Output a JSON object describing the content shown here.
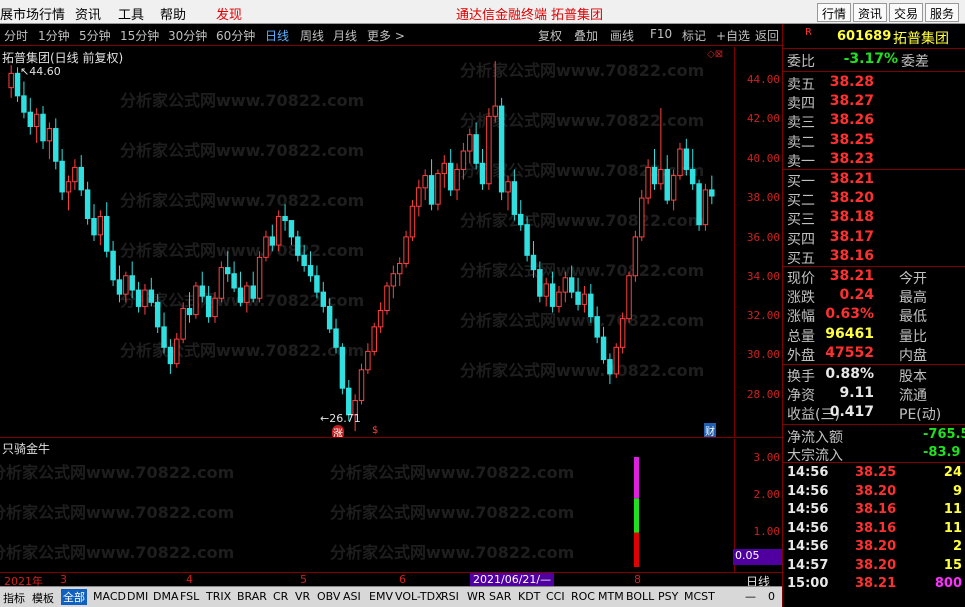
{
  "menu": {
    "items": [
      "展市场行情",
      "资讯",
      "工具",
      "帮助",
      "发现"
    ],
    "center_links": [
      "通达信金融终端",
      "拓普集团"
    ],
    "right_buttons": [
      "行情",
      "资讯",
      "交易",
      "服务"
    ]
  },
  "periods": [
    "分时",
    "1分钟",
    "5分钟",
    "15分钟",
    "30分钟",
    "60分钟",
    "日线",
    "周线",
    "月线",
    "更多 >"
  ],
  "selected_period": "日线",
  "toolbar": [
    "复权",
    "叠加",
    "画线",
    "F10",
    "标记",
    "+自选",
    "返回"
  ],
  "chart": {
    "title": "拓普集团(日线 前复权)",
    "high_marker": "44.60",
    "low_marker": "26.71",
    "price_ticks": [
      "44.00",
      "42.00",
      "40.00",
      "38.00",
      "36.00",
      "34.00",
      "32.00",
      "30.00",
      "28.00"
    ],
    "indicator_name": "只骑金牛",
    "indicator_ticks": [
      "3.00",
      "2.00",
      "1.00"
    ],
    "indicator_value": "0.05",
    "cursor_date": "2021/06/21/—",
    "period_label": "日线",
    "watermark": "分析家公式网www.70822.com",
    "badges": [
      "涨",
      "$",
      "财"
    ]
  },
  "chart_data": {
    "type": "candlestick",
    "title": "拓普集团(日线 前复权)",
    "ylim": [
      27,
      45
    ],
    "date_labels": [
      "2021年",
      "3",
      "4",
      "5",
      "6",
      "7",
      "8"
    ],
    "note_high": 44.6,
    "note_low": 26.71,
    "candles": [
      [
        43.5,
        44.6,
        43.0,
        44.2
      ],
      [
        44.2,
        44.5,
        42.8,
        43.1
      ],
      [
        43.1,
        43.8,
        42.0,
        42.3
      ],
      [
        42.3,
        43.0,
        41.2,
        41.6
      ],
      [
        41.6,
        42.5,
        40.8,
        42.2
      ],
      [
        42.2,
        42.6,
        40.5,
        40.9
      ],
      [
        40.9,
        41.8,
        40.0,
        41.5
      ],
      [
        41.5,
        42.0,
        39.5,
        39.9
      ],
      [
        39.9,
        40.5,
        38.0,
        38.4
      ],
      [
        38.4,
        39.2,
        37.5,
        38.9
      ],
      [
        38.9,
        40.0,
        38.5,
        39.6
      ],
      [
        39.6,
        40.2,
        38.2,
        38.5
      ],
      [
        38.5,
        38.9,
        36.8,
        37.1
      ],
      [
        37.1,
        37.8,
        36.0,
        36.3
      ],
      [
        36.3,
        37.5,
        35.8,
        37.2
      ],
      [
        37.2,
        37.9,
        35.2,
        35.5
      ],
      [
        35.5,
        36.0,
        33.8,
        34.1
      ],
      [
        34.1,
        34.8,
        33.0,
        33.4
      ],
      [
        33.4,
        34.5,
        33.0,
        34.3
      ],
      [
        34.3,
        35.0,
        33.2,
        33.6
      ],
      [
        33.6,
        34.0,
        32.5,
        32.8
      ],
      [
        32.8,
        33.9,
        32.4,
        33.6
      ],
      [
        33.6,
        34.2,
        32.8,
        33.0
      ],
      [
        33.0,
        33.4,
        31.5,
        31.8
      ],
      [
        31.8,
        32.5,
        30.5,
        30.8
      ],
      [
        30.8,
        31.2,
        29.5,
        30.0
      ],
      [
        30.0,
        31.5,
        29.8,
        31.2
      ],
      [
        31.2,
        33.0,
        31.0,
        32.7
      ],
      [
        32.7,
        33.5,
        32.0,
        32.4
      ],
      [
        32.4,
        34.0,
        32.2,
        33.8
      ],
      [
        33.8,
        34.5,
        33.0,
        33.3
      ],
      [
        33.3,
        33.8,
        32.0,
        32.3
      ],
      [
        32.3,
        33.5,
        32.0,
        33.2
      ],
      [
        33.2,
        35.0,
        33.0,
        34.7
      ],
      [
        34.7,
        35.5,
        34.0,
        34.4
      ],
      [
        34.4,
        35.0,
        33.5,
        33.7
      ],
      [
        33.7,
        34.5,
        32.8,
        33.0
      ],
      [
        33.0,
        34.0,
        32.5,
        33.8
      ],
      [
        33.8,
        34.5,
        33.0,
        33.2
      ],
      [
        33.2,
        35.5,
        33.0,
        35.2
      ],
      [
        35.2,
        36.5,
        35.0,
        36.2
      ],
      [
        36.2,
        36.8,
        35.5,
        35.8
      ],
      [
        35.8,
        37.5,
        35.5,
        37.2
      ],
      [
        37.2,
        37.8,
        36.5,
        37.0
      ],
      [
        37.0,
        36.9,
        35.8,
        36.2
      ],
      [
        36.2,
        36.5,
        35.0,
        35.3
      ],
      [
        35.3,
        35.8,
        34.5,
        34.8
      ],
      [
        34.8,
        35.5,
        34.0,
        34.3
      ],
      [
        34.3,
        34.8,
        33.2,
        33.5
      ],
      [
        33.5,
        34.0,
        32.5,
        32.8
      ],
      [
        32.8,
        33.2,
        31.5,
        31.7
      ],
      [
        31.7,
        32.2,
        30.5,
        30.8
      ],
      [
        30.8,
        31.0,
        28.5,
        28.8
      ],
      [
        28.8,
        29.2,
        27.2,
        27.5
      ],
      [
        27.5,
        28.5,
        26.7,
        28.2
      ],
      [
        28.2,
        30.0,
        28.0,
        29.7
      ],
      [
        29.7,
        31.0,
        29.5,
        30.6
      ],
      [
        30.6,
        32.0,
        30.4,
        31.8
      ],
      [
        31.8,
        33.0,
        31.5,
        32.6
      ],
      [
        32.6,
        34.0,
        32.4,
        33.8
      ],
      [
        33.8,
        34.8,
        33.2,
        34.4
      ],
      [
        34.4,
        35.2,
        33.8,
        34.9
      ],
      [
        34.9,
        36.5,
        34.7,
        36.2
      ],
      [
        36.2,
        38.0,
        36.0,
        37.7
      ],
      [
        37.7,
        39.0,
        37.2,
        38.6
      ],
      [
        38.6,
        39.5,
        38.0,
        39.2
      ],
      [
        39.2,
        40.0,
        37.5,
        37.8
      ],
      [
        37.8,
        39.5,
        37.5,
        39.3
      ],
      [
        39.3,
        40.2,
        38.6,
        39.8
      ],
      [
        39.8,
        40.5,
        38.2,
        38.5
      ],
      [
        38.5,
        39.8,
        38.0,
        39.5
      ],
      [
        39.5,
        40.8,
        39.0,
        40.4
      ],
      [
        40.4,
        41.5,
        39.8,
        41.2
      ],
      [
        41.2,
        41.8,
        39.5,
        39.8
      ],
      [
        39.8,
        40.5,
        38.5,
        38.8
      ],
      [
        38.8,
        42.5,
        38.5,
        42.1
      ],
      [
        42.1,
        44.8,
        41.8,
        42.6
      ],
      [
        42.6,
        43.0,
        38.0,
        38.4
      ],
      [
        38.4,
        39.2,
        37.5,
        38.9
      ],
      [
        38.9,
        39.5,
        37.0,
        37.3
      ],
      [
        37.3,
        38.0,
        36.5,
        36.8
      ],
      [
        36.8,
        37.2,
        35.0,
        35.3
      ],
      [
        35.3,
        36.0,
        34.2,
        34.6
      ],
      [
        34.6,
        35.0,
        33.0,
        33.3
      ],
      [
        33.3,
        34.2,
        32.8,
        33.9
      ],
      [
        33.9,
        34.5,
        32.5,
        32.8
      ],
      [
        32.8,
        33.8,
        32.5,
        33.5
      ],
      [
        33.5,
        34.5,
        33.0,
        34.2
      ],
      [
        34.2,
        34.8,
        33.2,
        33.5
      ],
      [
        33.5,
        34.2,
        32.6,
        32.9
      ],
      [
        32.9,
        33.8,
        32.5,
        33.4
      ],
      [
        33.4,
        33.9,
        32.0,
        32.3
      ],
      [
        32.3,
        32.8,
        31.0,
        31.3
      ],
      [
        31.3,
        31.8,
        30.0,
        30.2
      ],
      [
        30.2,
        30.5,
        29.0,
        29.5
      ],
      [
        29.5,
        31.0,
        29.3,
        30.8
      ],
      [
        30.8,
        32.5,
        30.5,
        32.2
      ],
      [
        32.2,
        34.5,
        32.0,
        34.3
      ],
      [
        34.3,
        36.5,
        34.0,
        36.2
      ],
      [
        36.2,
        38.5,
        36.0,
        38.1
      ],
      [
        38.1,
        40.0,
        37.8,
        39.6
      ],
      [
        39.6,
        40.5,
        38.5,
        38.8
      ],
      [
        38.8,
        42.5,
        38.5,
        39.5
      ],
      [
        39.5,
        40.2,
        37.8,
        38.0
      ],
      [
        38.0,
        39.5,
        37.5,
        39.2
      ],
      [
        39.2,
        40.8,
        39.0,
        40.5
      ],
      [
        40.5,
        41.0,
        39.2,
        39.5
      ],
      [
        39.5,
        40.5,
        38.5,
        38.8
      ],
      [
        38.8,
        39.0,
        36.5,
        36.8
      ],
      [
        36.8,
        38.8,
        36.5,
        38.5
      ],
      [
        38.5,
        39.2,
        37.8,
        38.2
      ]
    ],
    "indicator_bars": [
      {
        "segments": [
          {
            "color": "#e00000",
            "from": 0,
            "to": 1
          },
          {
            "color": "#20e020",
            "from": 1,
            "to": 2
          },
          {
            "color": "#e020e0",
            "from": 2,
            "to": 3.2
          }
        ]
      }
    ]
  },
  "quote": {
    "code": "601689",
    "name": "拓普集团",
    "weibi_label": "委比",
    "weibi_value": "-3.17%",
    "weicha_label": "委差",
    "asks": [
      {
        "label": "卖五",
        "price": "38.28"
      },
      {
        "label": "卖四",
        "price": "38.27"
      },
      {
        "label": "卖三",
        "price": "38.26"
      },
      {
        "label": "卖二",
        "price": "38.25"
      },
      {
        "label": "卖一",
        "price": "38.23"
      }
    ],
    "bids": [
      {
        "label": "买一",
        "price": "38.21"
      },
      {
        "label": "买二",
        "price": "38.20"
      },
      {
        "label": "买三",
        "price": "38.18"
      },
      {
        "label": "买四",
        "price": "38.17"
      },
      {
        "label": "买五",
        "price": "38.16"
      }
    ],
    "stats": [
      {
        "label": "现价",
        "value": "38.21",
        "color": "red",
        "label2": "今开"
      },
      {
        "label": "涨跌",
        "value": "0.24",
        "color": "red",
        "label2": "最高"
      },
      {
        "label": "涨幅",
        "value": "0.63%",
        "color": "red",
        "label2": "最低"
      },
      {
        "label": "总量",
        "value": "96461",
        "color": "yellow",
        "label2": "量比"
      },
      {
        "label": "外盘",
        "value": "47552",
        "color": "red",
        "label2": "内盘"
      }
    ],
    "fundamentals": [
      {
        "label": "换手",
        "value": "0.88%",
        "label2": "股本"
      },
      {
        "label": "净资",
        "value": "9.11",
        "label2": "流通"
      },
      {
        "label": "收益(三)",
        "value": "0.417",
        "label2": "PE(动)"
      }
    ],
    "flows": [
      {
        "label": "净流入额",
        "value": "-765.5"
      },
      {
        "label": "大宗流入",
        "value": "-83.9"
      }
    ],
    "ticks": [
      {
        "time": "14:56",
        "price": "38.25",
        "vol": "24",
        "vcolor": "yellow"
      },
      {
        "time": "14:56",
        "price": "38.20",
        "vol": "9",
        "vcolor": "yellow"
      },
      {
        "time": "14:56",
        "price": "38.16",
        "vol": "11",
        "vcolor": "yellow"
      },
      {
        "time": "14:56",
        "price": "38.16",
        "vol": "11",
        "vcolor": "yellow"
      },
      {
        "time": "14:56",
        "price": "38.20",
        "vol": "2",
        "vcolor": "yellow"
      },
      {
        "time": "14:57",
        "price": "38.20",
        "vol": "15",
        "vcolor": "yellow"
      },
      {
        "time": "15:00",
        "price": "38.21",
        "vol": "800",
        "vcolor": "magenta"
      }
    ]
  },
  "bottom_tabs": [
    "指标",
    "模板",
    "全部",
    "MACD",
    "DMI",
    "DMA",
    "FSL",
    "TRIX",
    "BRAR",
    "CR",
    "VR",
    "OBV",
    "ASI",
    "EMV",
    "VOL-TDX",
    "RSI",
    "WR",
    "SAR",
    "KDT",
    "CCI",
    "ROC",
    "MTM",
    "BOLL",
    "PSY",
    "MCST"
  ],
  "selected_tab": "全部",
  "bottom_right": [
    "—",
    "0"
  ]
}
